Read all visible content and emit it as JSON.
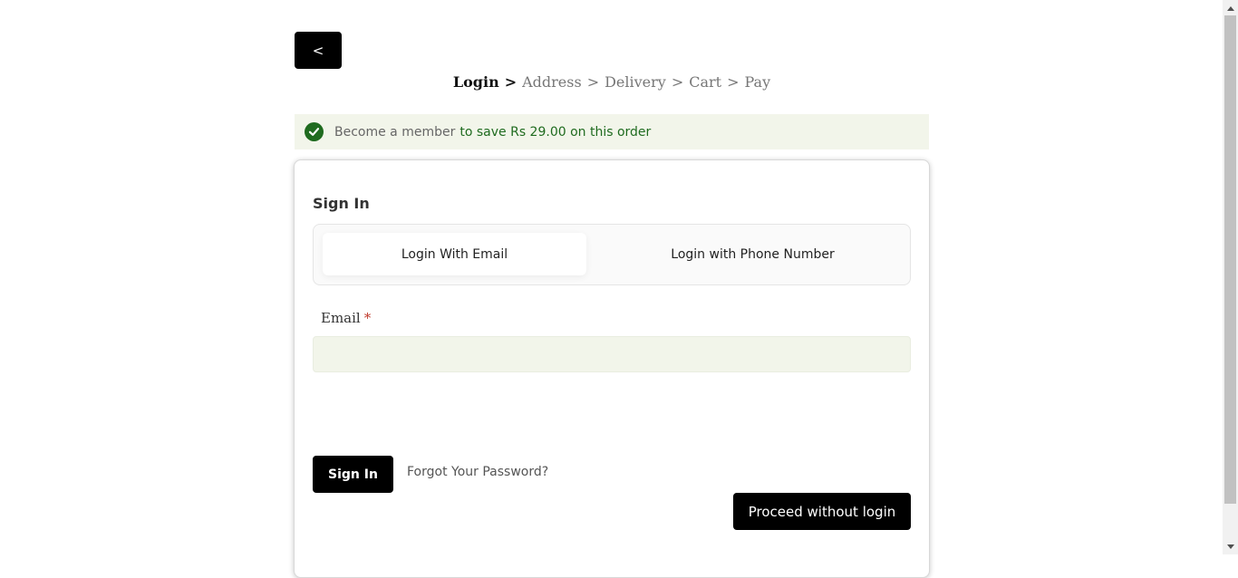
{
  "nav": {
    "back_label": "<"
  },
  "breadcrumb": {
    "steps": [
      "Login",
      "Address",
      "Delivery",
      "Cart",
      "Pay"
    ],
    "separator": ">",
    "active_index": 0
  },
  "banner": {
    "muted_text": "Become a member",
    "highlight_text": "to save Rs 29.00 on this order",
    "icon": "check-circle-icon",
    "icon_color": "#1f6b1f",
    "background": "#f2f5ea"
  },
  "signin": {
    "title": "Sign In",
    "tabs": [
      {
        "label": "Login With Email",
        "active": true
      },
      {
        "label": "Login with Phone Number",
        "active": false
      }
    ],
    "email_label": "Email",
    "required_mark": "*",
    "email_value": "",
    "email_placeholder": "",
    "submit_label": "Sign In",
    "forgot_label": "Forgot Your Password?",
    "proceed_label": "Proceed without login"
  },
  "colors": {
    "button_bg": "#000000",
    "button_text": "#ffffff",
    "accent_green": "#1f6b1f"
  }
}
